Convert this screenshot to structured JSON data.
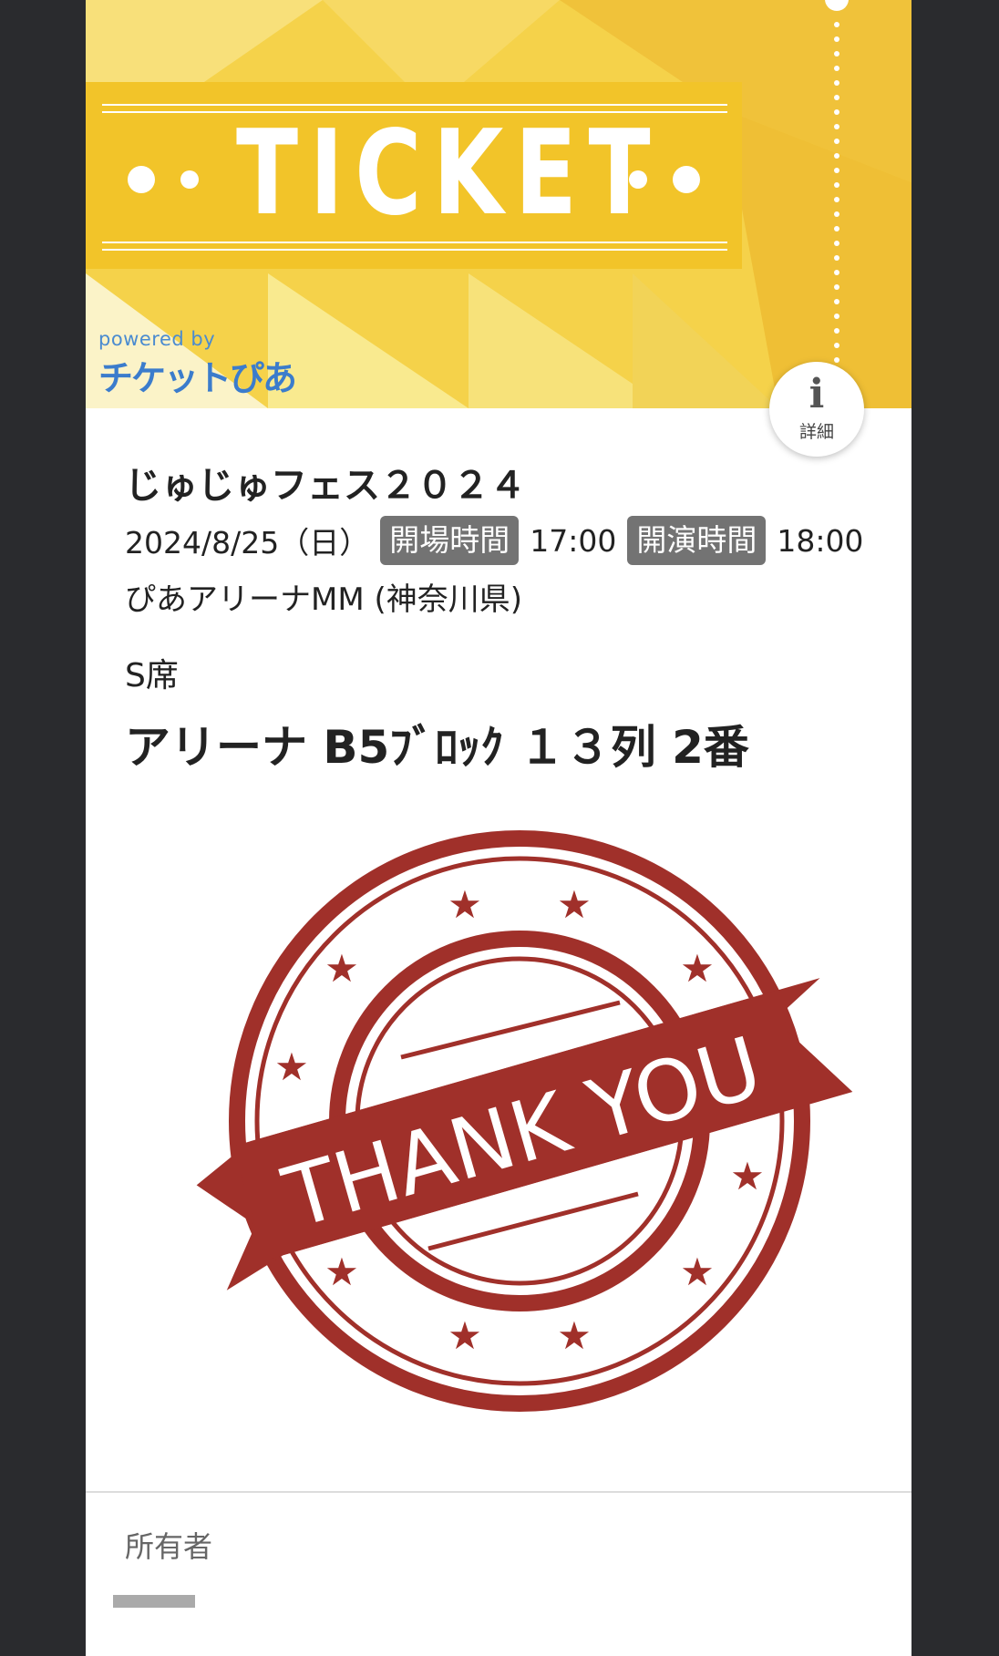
{
  "header": {
    "ticket_word": "TICKET",
    "logo_powered": "powered by",
    "logo_brand": "チケットぴあ",
    "colors": {
      "banner": "#f2c429",
      "background": "#f5d24a"
    }
  },
  "info_button": {
    "icon": "info-icon",
    "label": "詳細"
  },
  "event": {
    "title": "じゅじゅフェス２０２４",
    "date": "2024/8/25（日）",
    "open_label": "開場時間",
    "open_time": "17:00",
    "start_label": "開演時間",
    "start_time": "18:00",
    "venue": "ぴあアリーナMM (神奈川県)"
  },
  "seat": {
    "class": "S席",
    "location": "アリーナ B5ﾌﾞﾛｯｸ １３列 2番"
  },
  "stamp": {
    "text": "THANK YOU",
    "color": "#a0302a"
  },
  "owner": {
    "label": "所有者"
  }
}
